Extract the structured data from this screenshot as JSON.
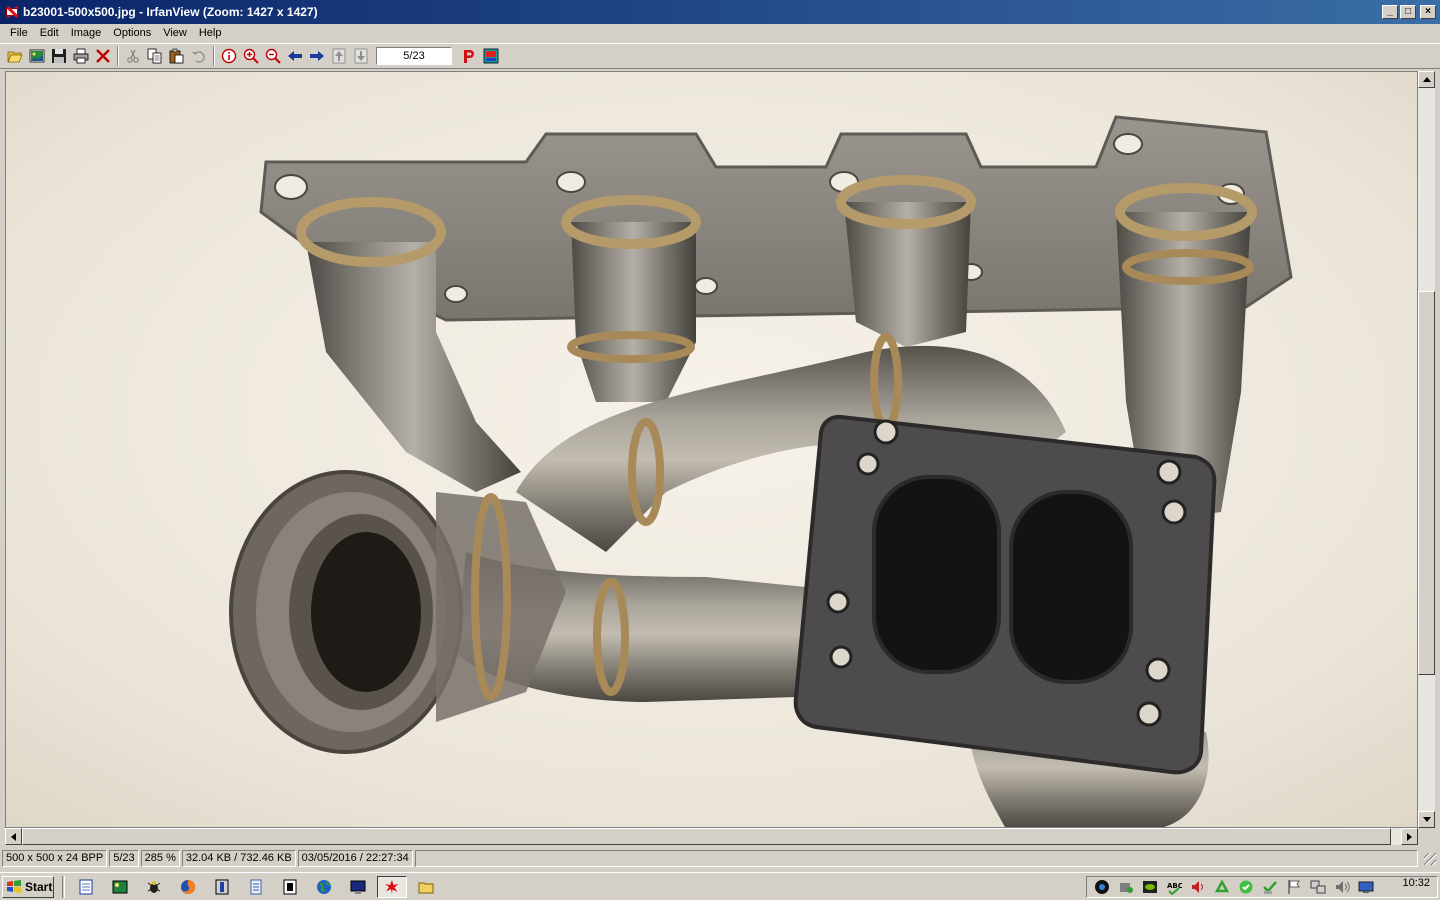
{
  "window": {
    "title": "b23001-500x500.jpg - IrfanView (Zoom: 1427 x 1427)",
    "minimize_label": "_",
    "maximize_label": "□",
    "close_label": "×"
  },
  "menu": {
    "items": [
      "File",
      "Edit",
      "Image",
      "Options",
      "View",
      "Help"
    ]
  },
  "toolbar": {
    "page_indicator": "5/23"
  },
  "statusbar": {
    "dimensions": "500 x 500 x 24 BPP",
    "position": "5/23",
    "zoom": "285 %",
    "size": "32.04 KB / 732.46 KB",
    "datetime": "03/05/2016 / 22:27:34"
  },
  "taskbar": {
    "start_label": "Start",
    "clock": "10:32"
  },
  "icons": {
    "open": "folder-open-icon",
    "thumbnails": "thumbnails-icon",
    "save": "save-icon",
    "print": "print-icon",
    "delete": "delete-icon",
    "cut": "cut-icon",
    "copy": "copy-icon",
    "paste": "paste-icon",
    "undo": "undo-icon",
    "info": "info-icon",
    "zoom_in": "zoom-in-icon",
    "zoom_out": "zoom-out-icon",
    "prev": "arrow-left-icon",
    "next": "arrow-right-icon",
    "first": "first-page-icon",
    "last": "last-page-icon",
    "paint": "paint-icon",
    "slideshow": "slideshow-icon"
  },
  "colors": {
    "titlebar_start": "#0a246a",
    "titlebar_end": "#3a6ea5",
    "chrome": "#d4d0c8"
  }
}
